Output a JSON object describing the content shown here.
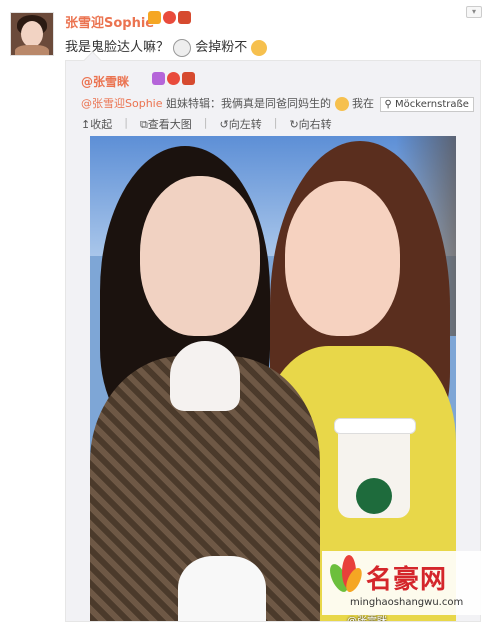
{
  "post": {
    "username": "张雪迎Sophie",
    "text": "我是鬼脸达人嘛？",
    "text_tail": "会掉粉不"
  },
  "repost": {
    "username": "@张雪眯",
    "mention": "@张雪迎Sophie",
    "body": " 姐妹特辑：我俩真是同爸同妈生的",
    "location_prefix": "我在",
    "location": "Möckernstraße",
    "actions": [
      "收起",
      "查看大图",
      "向左转",
      "向右转"
    ],
    "photo_credit": "@张雪眯"
  },
  "watermark": {
    "title": "名豪网",
    "url": "minghaoshangwu.com"
  },
  "colors": {
    "name": "#eb7350",
    "brand_red": "#d4262b"
  }
}
